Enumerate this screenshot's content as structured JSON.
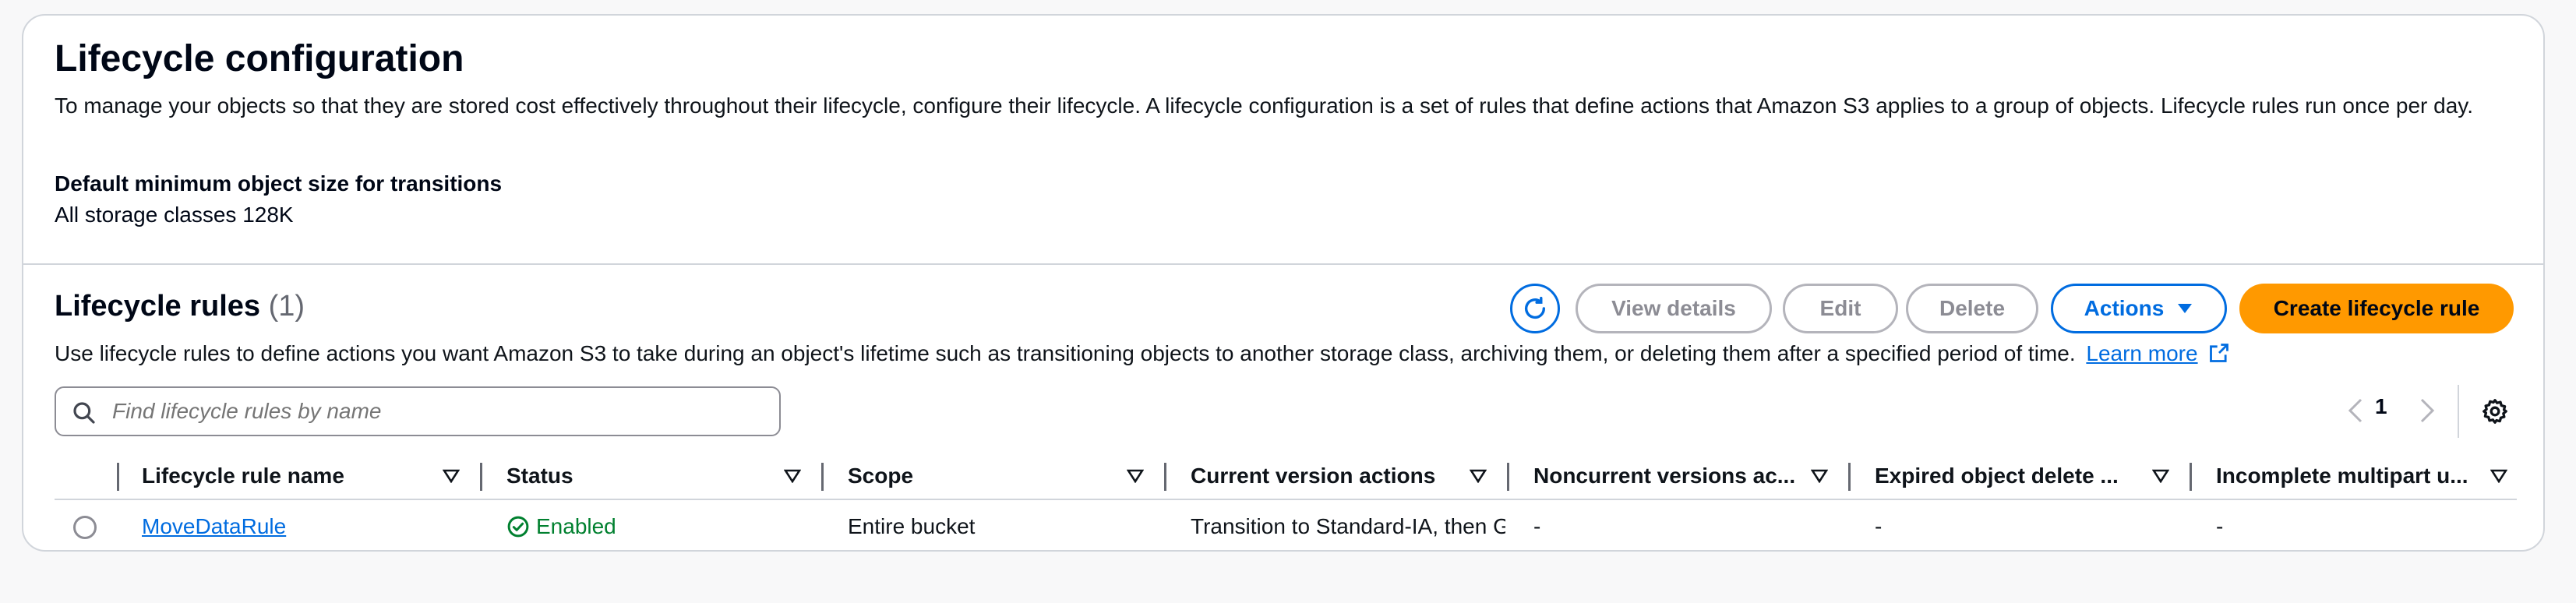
{
  "lifecycle_config": {
    "title": "Lifecycle configuration",
    "description": "To manage your objects so that they are stored cost effectively throughout their lifecycle, configure their lifecycle. A lifecycle configuration is a set of rules that define actions that Amazon S3 applies to a group of objects. Lifecycle rules run once per day.",
    "min_size_label": "Default minimum object size for transitions",
    "min_size_value": "All storage classes 128K"
  },
  "rules": {
    "title": "Lifecycle rules",
    "count": "(1)",
    "description": "Use lifecycle rules to define actions you want Amazon S3 to take during an object's lifetime such as transitioning objects to another storage class, archiving them, or deleting them after a specified period of time.",
    "learn_more": "Learn more",
    "buttons": {
      "view_details": "View details",
      "edit": "Edit",
      "delete": "Delete",
      "actions": "Actions",
      "create": "Create lifecycle rule"
    },
    "search_placeholder": "Find lifecycle rules by name",
    "page": "1",
    "columns": [
      "Lifecycle rule name",
      "Status",
      "Scope",
      "Current version actions",
      "Noncurrent versions ac...",
      "Expired object delete ...",
      "Incomplete multipart u..."
    ],
    "rows": [
      {
        "name": "MoveDataRule",
        "status": "Enabled",
        "scope": "Entire bucket",
        "current_actions": "Transition to Standard-IA, then Glacier",
        "noncurrent": "-",
        "expired": "-",
        "incomplete": "-"
      }
    ]
  },
  "colors": {
    "primary": "#ff9900",
    "link": "#006ce0",
    "success": "#00802f"
  }
}
